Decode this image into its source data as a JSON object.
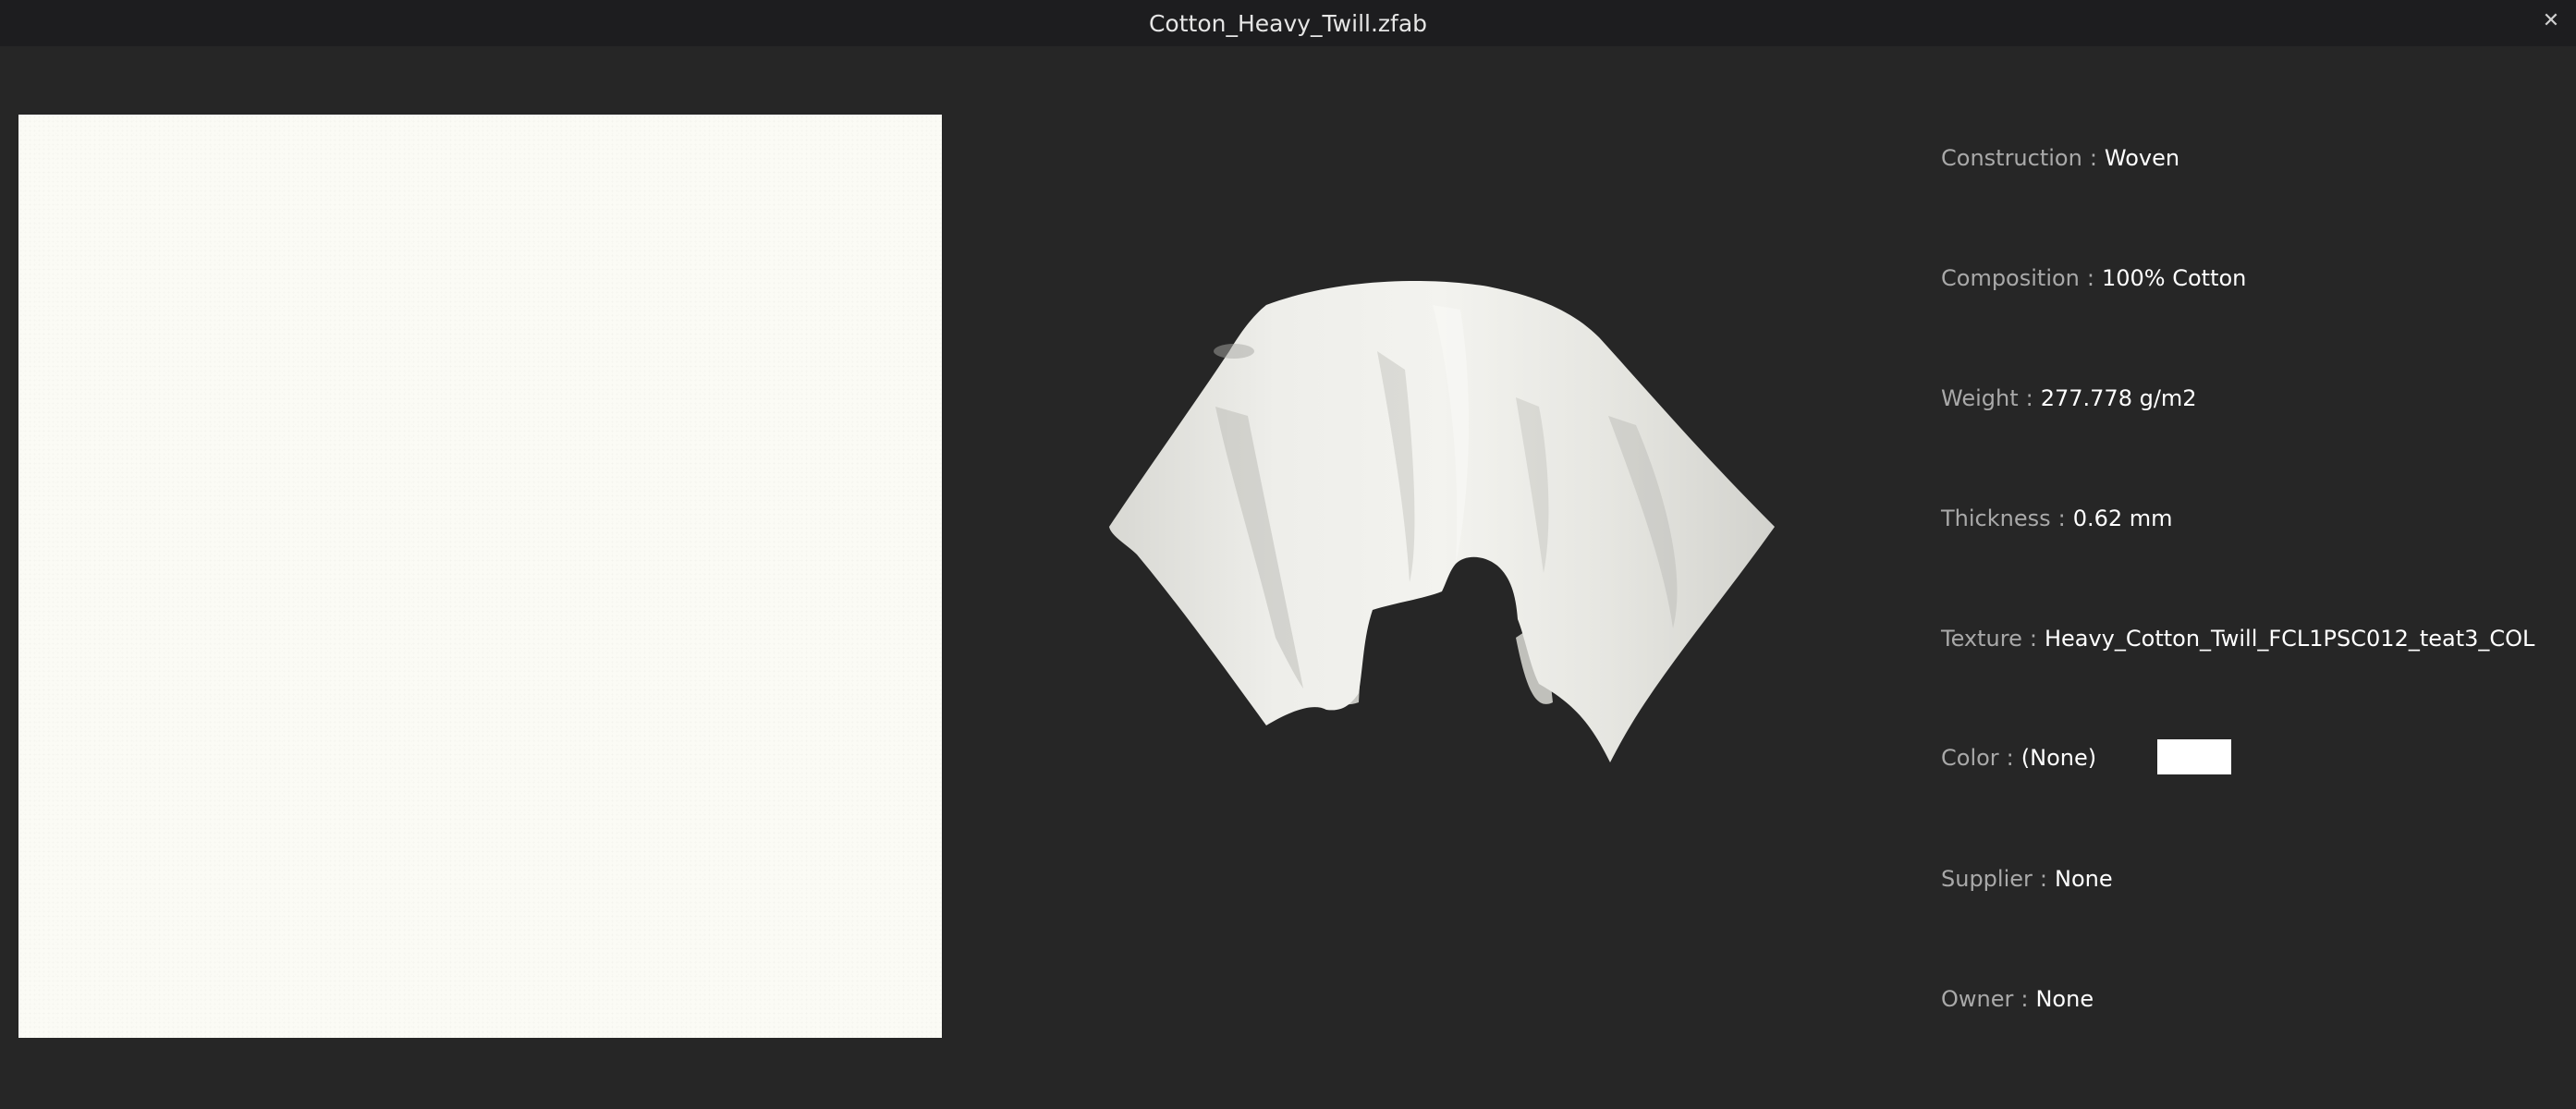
{
  "window": {
    "title": "Cotton_Heavy_Twill.zfab",
    "close_glyph": "✕"
  },
  "properties": [
    {
      "label": "Construction",
      "value": "Woven"
    },
    {
      "label": "Composition",
      "value": "100% Cotton"
    },
    {
      "label": "Weight",
      "value": "277.778 g/m2"
    },
    {
      "label": "Thickness",
      "value": "0.62 mm"
    },
    {
      "label": "Texture",
      "value": "Heavy_Cotton_Twill_FCL1PSC012_teat3_COL"
    },
    {
      "label": "Color",
      "value": "(None)"
    },
    {
      "label": "Supplier",
      "value": "None"
    },
    {
      "label": "Owner",
      "value": "None"
    }
  ],
  "separator": ":",
  "colors": {
    "background": "#262626",
    "titlebar": "#1d1d1f",
    "fabric": "#fbfbf5",
    "color_swatch": "#ffffff"
  }
}
